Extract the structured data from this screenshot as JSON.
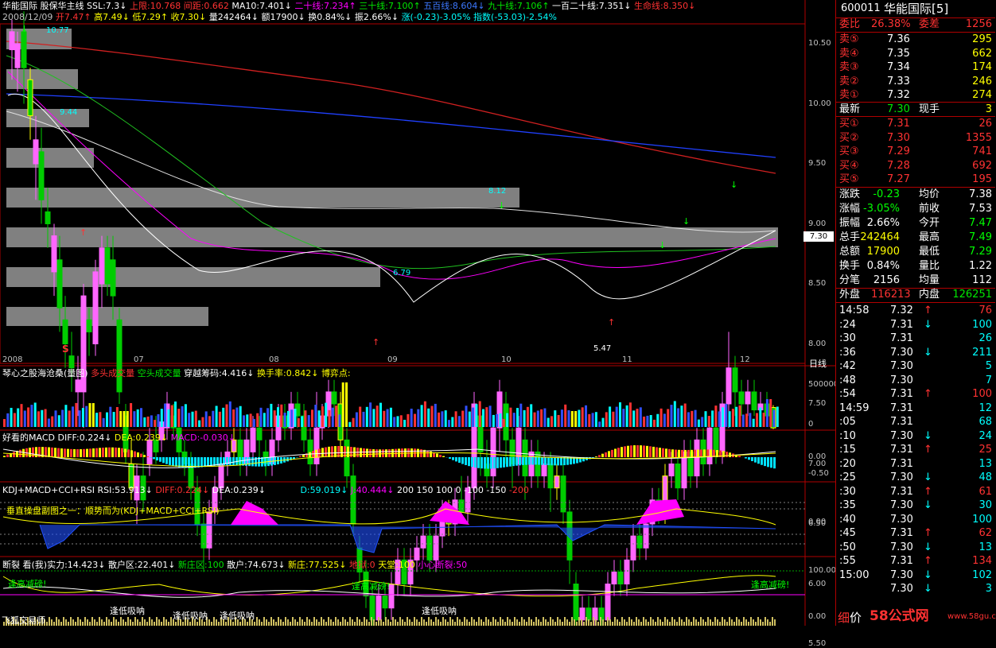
{
  "header": {
    "stock": "华能国际",
    "formula": "股保华主线",
    "ssl": "SSL:7.3↓",
    "upper": "上限:10.768",
    "gap": "间距:0.662",
    "ma10": "MA10:7.401↓",
    "line20": "二十线:7.234↑",
    "line30": "三十线:7.100↑",
    "line50": "五百线:8.604↓",
    "line90": "九十线:7.106↑",
    "line120": "一百二十线:7.351↓",
    "lifeline": "生命线:8.350↓",
    "date": "2008/12/09",
    "open": "开7.47↑",
    "high": "高7.49↓",
    "low": "低7.29↑",
    "close": "收7.30↓",
    "volume": "量242464↓",
    "amount": "额17900↓",
    "turnover": "换0.84%↓",
    "amplitude": "振2.66%↓",
    "change": "涨(-0.23)-3.05%",
    "index": "指数(-53.03)-2.54%"
  },
  "price_axis": [
    "10.50",
    "10.00",
    "9.50",
    "9.00",
    "8.50",
    "8.00",
    "7.50",
    "7.00",
    "6.50",
    "6.00",
    "5.50"
  ],
  "current_price_tag": "7.30",
  "price_annotations": {
    "top": "10.77",
    "a": "9.44",
    "b": "8.12",
    "c": "6.79",
    "low": "5.47"
  },
  "date_axis": [
    "2008",
    "07",
    "08",
    "09",
    "10",
    "11",
    "12"
  ],
  "period_label": "日线",
  "s_marker": "S",
  "vol_panel": {
    "title": "琴心之股海沧桑(量图)",
    "long": "多头成交量",
    "short": "空头成交量",
    "chip": "穿越筹码:4.416↓",
    "turnover": "换手率:0.842↓",
    "game": "博弈点:",
    "axis_top": "500000",
    "axis_zero": "0"
  },
  "macd_panel": {
    "title": "好看的MACD",
    "diff": "DIFF:0.224↓",
    "dea": "DEA:0.239↓",
    "macd": "MACD:-0.030↓",
    "axis": [
      "0.00",
      "-0.50"
    ]
  },
  "kdj_panel": {
    "title": "KDJ+MACD+CCI+RSI",
    "rsi": "RSI:53.913↓",
    "diff": "DIFF:0.224↓",
    "dea": "DEA:0.239↓",
    "d": "D:59.019↓",
    "j": "J:40.444↓",
    "levels": "200  150  100  0  -100  -150",
    "level_neg": "-200",
    "subtitle": "垂直操盘副图之一：顺势而为(KDJ+MACD+CCI+RSI)",
    "axis": "0.00"
  },
  "break_panel": {
    "title": "断裂",
    "view": "看(我)实力:14.423↓",
    "retail_zone": "散户区:22.401↓",
    "new_zone": "新庄区:100",
    "retail": "散户:74.673↓",
    "new": "新庄:77.525↓",
    "hell": "地狱:0",
    "heaven": "天堂:100",
    "crack": "小心断裂:50",
    "reduce1": "逢高减磅!",
    "reduce2": "逢高减磅!",
    "reduce3": "逢高减磅!",
    "absorb1": "逢低吸呐",
    "absorb2": "逢低吸呐",
    "absorb3": "逢低吸呐",
    "absorb4": "逢低吸呐",
    "trader": "飞狐交易师",
    "axis": [
      "100.00",
      "0.00"
    ]
  },
  "quote": {
    "code": "600011",
    "name": "华能国际[5]",
    "weibi_label": "委比",
    "weibi": "26.38%",
    "weicha_label": "委差",
    "weicha": "1256",
    "sells": [
      {
        "label": "卖⑤",
        "price": "7.36",
        "vol": "295"
      },
      {
        "label": "卖④",
        "price": "7.35",
        "vol": "662"
      },
      {
        "label": "卖③",
        "price": "7.34",
        "vol": "174"
      },
      {
        "label": "卖②",
        "price": "7.33",
        "vol": "246"
      },
      {
        "label": "卖①",
        "price": "7.32",
        "vol": "274"
      }
    ],
    "last_label": "最新",
    "last": "7.30",
    "hand_label": "现手",
    "hand": "3",
    "buys": [
      {
        "label": "买①",
        "price": "7.31",
        "vol": "26"
      },
      {
        "label": "买②",
        "price": "7.30",
        "vol": "1355"
      },
      {
        "label": "买③",
        "price": "7.29",
        "vol": "741"
      },
      {
        "label": "买④",
        "price": "7.28",
        "vol": "692"
      },
      {
        "label": "买⑤",
        "price": "7.27",
        "vol": "195"
      }
    ],
    "stats": [
      {
        "l1": "涨跌",
        "v1": "-0.23",
        "l2": "均价",
        "v2": "7.38",
        "c1": "#00ff00",
        "c2": "#ffffff"
      },
      {
        "l1": "涨幅",
        "v1": "-3.05%",
        "l2": "前收",
        "v2": "7.53",
        "c1": "#00ff00",
        "c2": "#ffffff"
      },
      {
        "l1": "振幅",
        "v1": "2.66%",
        "l2": "今开",
        "v2": "7.47",
        "c1": "#ffffff",
        "c2": "#00ff00"
      },
      {
        "l1": "总手",
        "v1": "242464",
        "l2": "最高",
        "v2": "7.49",
        "c1": "#ffff00",
        "c2": "#00ff00"
      },
      {
        "l1": "总额",
        "v1": "17900",
        "l2": "最低",
        "v2": "7.29",
        "c1": "#ffff00",
        "c2": "#00ff00"
      },
      {
        "l1": "换手",
        "v1": "0.84%",
        "l2": "量比",
        "v2": "1.22",
        "c1": "#ffffff",
        "c2": "#ffffff"
      },
      {
        "l1": "分笔",
        "v1": "2156",
        "l2": "均量",
        "v2": "112",
        "c1": "#ffffff",
        "c2": "#ffffff"
      }
    ],
    "outer_label": "外盘",
    "outer": "116213",
    "inner_label": "内盘",
    "inner": "126251",
    "ticks": [
      {
        "t": "14:58",
        "p": "7.32",
        "d": "↑",
        "v": "76",
        "c": "#ff3232"
      },
      {
        "t": ":24",
        "p": "7.31",
        "d": "↓",
        "v": "100",
        "c": "#00ffff"
      },
      {
        "t": ":30",
        "p": "7.31",
        "d": "",
        "v": "26",
        "c": "#00ffff"
      },
      {
        "t": ":36",
        "p": "7.30",
        "d": "↓",
        "v": "211",
        "c": "#00ffff"
      },
      {
        "t": ":42",
        "p": "7.30",
        "d": "",
        "v": "5",
        "c": "#00ffff"
      },
      {
        "t": ":48",
        "p": "7.30",
        "d": "",
        "v": "7",
        "c": "#00ffff"
      },
      {
        "t": ":54",
        "p": "7.31",
        "d": "↑",
        "v": "100",
        "c": "#ff3232"
      },
      {
        "t": "14:59",
        "p": "7.31",
        "d": "",
        "v": "12",
        "c": "#00ffff"
      },
      {
        "t": ":05",
        "p": "7.31",
        "d": "",
        "v": "68",
        "c": "#00ffff"
      },
      {
        "t": ":10",
        "p": "7.30",
        "d": "↓",
        "v": "24",
        "c": "#00ffff"
      },
      {
        "t": ":15",
        "p": "7.31",
        "d": "↑",
        "v": "25",
        "c": "#ff3232"
      },
      {
        "t": ":20",
        "p": "7.31",
        "d": "",
        "v": "13",
        "c": "#00ffff"
      },
      {
        "t": ":25",
        "p": "7.30",
        "d": "↓",
        "v": "48",
        "c": "#00ffff"
      },
      {
        "t": ":30",
        "p": "7.31",
        "d": "↑",
        "v": "61",
        "c": "#ff3232"
      },
      {
        "t": ":35",
        "p": "7.30",
        "d": "↓",
        "v": "30",
        "c": "#00ffff"
      },
      {
        "t": ":40",
        "p": "7.30",
        "d": "",
        "v": "100",
        "c": "#00ffff"
      },
      {
        "t": ":45",
        "p": "7.31",
        "d": "↑",
        "v": "62",
        "c": "#ff3232"
      },
      {
        "t": ":50",
        "p": "7.30",
        "d": "↓",
        "v": "13",
        "c": "#00ffff"
      },
      {
        "t": ":55",
        "p": "7.31",
        "d": "↑",
        "v": "134",
        "c": "#ff3232"
      },
      {
        "t": "15:00",
        "p": "7.30",
        "d": "↓",
        "v": "102",
        "c": "#00ffff"
      },
      {
        "t": "",
        "p": "7.30",
        "d": "↓",
        "v": "3",
        "c": "#00ffff"
      }
    ],
    "tab_detail": "细",
    "tab_price": "价",
    "watermark": "58公式网",
    "watermark_url": "www.58gu.com"
  },
  "colors": {
    "up": "#ff3232",
    "down": "#00ffff",
    "accent": "#b00000",
    "band": "#808080"
  }
}
